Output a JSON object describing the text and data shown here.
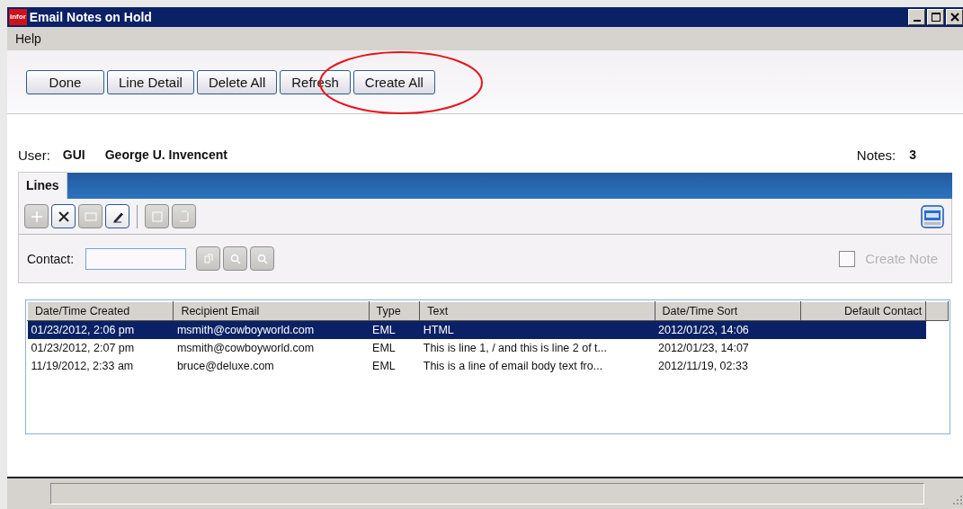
{
  "window": {
    "logo": "infor",
    "title": "Email Notes on Hold"
  },
  "menu": [
    {
      "label": "Help"
    }
  ],
  "buttons": [
    {
      "label": "Done",
      "highlighted": false
    },
    {
      "label": "Line Detail",
      "highlighted": false
    },
    {
      "label": "Delete All",
      "highlighted": false
    },
    {
      "label": "Refresh",
      "highlighted": false
    },
    {
      "label": "Create All",
      "highlighted": true
    }
  ],
  "user": {
    "label": "User:",
    "code": "GUI",
    "name": "George U. Invencent"
  },
  "notes": {
    "label": "Notes:",
    "count": "3"
  },
  "tabs": [
    {
      "label": "Lines",
      "selected": true
    }
  ],
  "toolbar": [
    {
      "disabled": true
    },
    {
      "disabled": false
    },
    {
      "disabled": true
    },
    {
      "disabled": false
    },
    {
      "disabled": true
    },
    {
      "disabled": true
    }
  ],
  "contact": {
    "label": "Contact:",
    "lookups": [
      {
        "disabled": true
      },
      {
        "disabled": true
      },
      {
        "disabled": true
      }
    ]
  },
  "create_note": {
    "label": "Create Note",
    "checked": false,
    "disabled": true
  },
  "table": {
    "columns": [
      "Date/Time Created",
      "Recipient Email",
      "Type",
      "Text",
      "Date/Time Sort",
      "Default Contact"
    ],
    "rows": [
      {
        "selected": true,
        "cells": [
          "01/23/2012, 2:06 pm",
          "msmith@cowboyworld.com",
          "EML",
          "HTML",
          "2012/01/23, 14:06",
          ""
        ]
      },
      {
        "selected": false,
        "cells": [
          "01/23/2012, 2:07 pm",
          "msmith@cowboyworld.com",
          "EML",
          "This is line 1, / and this is line 2 of t...",
          "2012/01/23, 14:07",
          ""
        ]
      },
      {
        "selected": false,
        "cells": [
          "11/19/2012, 2:33 am",
          "bruce@deluxe.com",
          "EML",
          "This is a line of email body text fro...",
          "2012/11/19, 02:33",
          ""
        ]
      }
    ]
  }
}
